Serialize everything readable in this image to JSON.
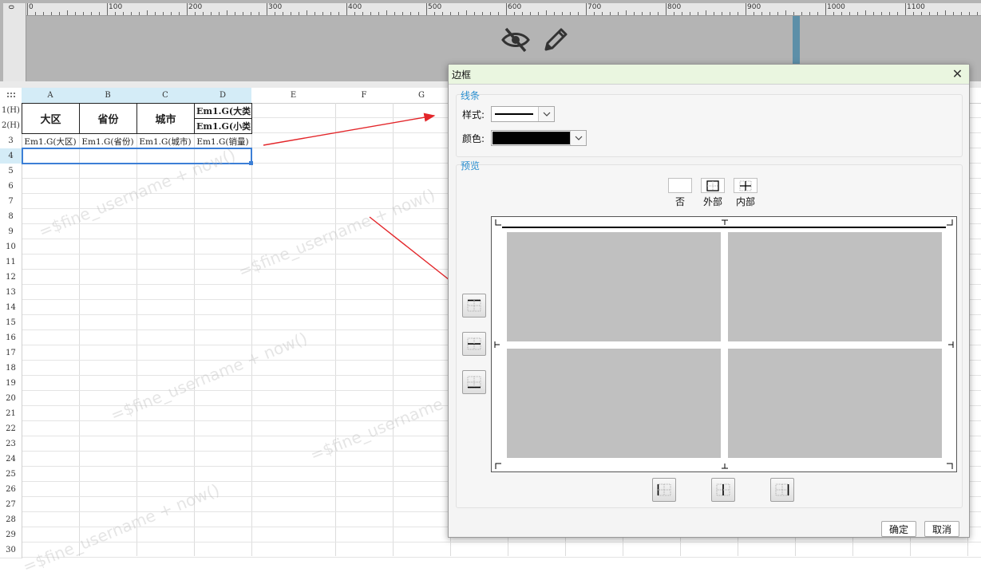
{
  "ruler": {
    "h_labels": [
      "0",
      "100",
      "200",
      "300",
      "400",
      "500",
      "600",
      "700",
      "800",
      "900",
      "1000",
      "1100"
    ],
    "v_label": "0"
  },
  "toolbar": {
    "icons": [
      "eye-slash-icon",
      "pencil-icon"
    ]
  },
  "sheet": {
    "columns": [
      "A",
      "B",
      "C",
      "D",
      "E",
      "F",
      "G"
    ],
    "rows": [
      "1(H)",
      "2(H)",
      "3",
      "4",
      "5",
      "6",
      "7",
      "8",
      "9",
      "10",
      "11",
      "12",
      "13",
      "14",
      "15",
      "16",
      "17",
      "18",
      "19",
      "20",
      "21",
      "22",
      "23",
      "24",
      "25",
      "26",
      "27",
      "28",
      "29",
      "30"
    ],
    "selected_column_letters": [
      "A",
      "B",
      "C",
      "D"
    ],
    "selected_row": "4",
    "header_cells": {
      "region": "大区",
      "province": "省份",
      "city": "城市"
    },
    "d1": "Em1.G(大类",
    "d2": "Em1.G(小类",
    "row3": [
      "Em1.G(大区)",
      "Em1.G(省份)",
      "Em1.G(城市)",
      "Em1.G(销量)"
    ],
    "watermark": "=$fine_username + now()"
  },
  "dialog": {
    "title": "边框",
    "close_symbol": "✕",
    "line_section": "线条",
    "style_label": "样式:",
    "color_label": "颜色:",
    "color_value": "#000000",
    "preview_section": "预览",
    "presets": [
      {
        "label": "否",
        "icon": "none-border-icon"
      },
      {
        "label": "外部",
        "icon": "outer-border-icon"
      },
      {
        "label": "内部",
        "icon": "inner-border-icon"
      }
    ],
    "confirm": "确定",
    "cancel": "取消"
  },
  "colors": {
    "accent_blue": "#2a8fd0",
    "selection": "#3c7fd6",
    "arrow_red": "#e3262a",
    "title_bar": "#eaf6e0"
  }
}
